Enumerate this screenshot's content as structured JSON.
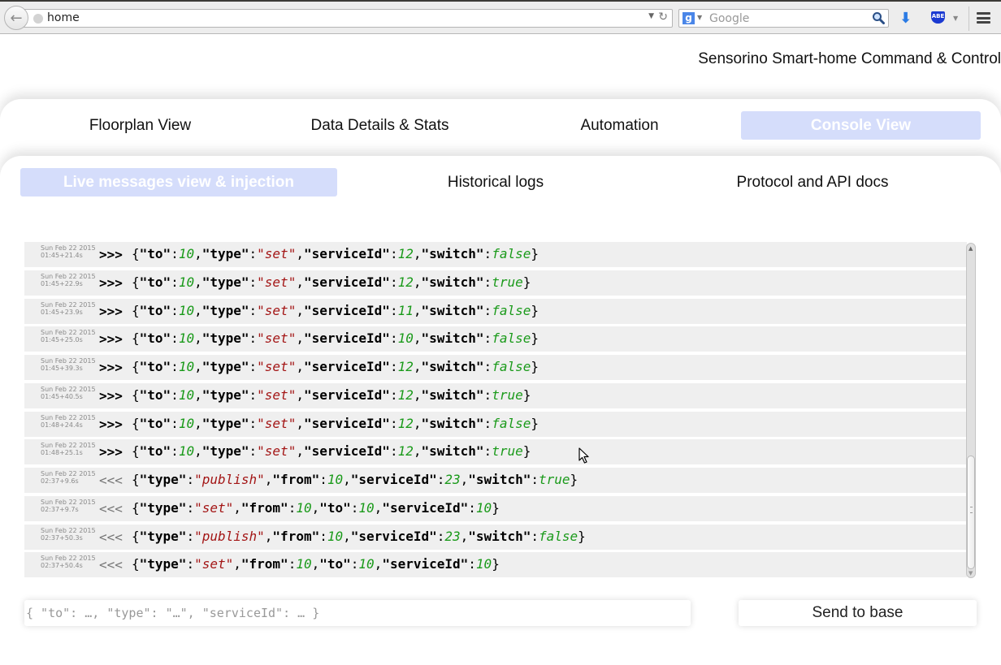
{
  "browser": {
    "url": "home",
    "search_placeholder": "Google",
    "search_engine_icon": "g",
    "extension_label": "ABE"
  },
  "site": {
    "title": "Sensorino Smart-home Command & Control"
  },
  "main_tabs": [
    {
      "label": "Floorplan View",
      "active": false
    },
    {
      "label": "Data Details & Stats",
      "active": false
    },
    {
      "label": "Automation",
      "active": false
    },
    {
      "label": "Console View",
      "active": true
    }
  ],
  "sub_tabs": [
    {
      "label": "Live messages view & injection",
      "active": true
    },
    {
      "label": "Historical logs",
      "active": false
    },
    {
      "label": "Protocol and API docs",
      "active": false
    }
  ],
  "colors": {
    "active_tab_bg": "#d5ddfb",
    "string_value": "#a31515",
    "number_value": "#1a9a1a",
    "row_bg": "#efefef"
  },
  "log": {
    "rows": [
      {
        "date": "Sun Feb 22 2015",
        "time": "01:45+21.4s",
        "dir": ">>>",
        "direction": "out",
        "tokens": [
          [
            "p",
            "{"
          ],
          [
            "k",
            "\"to\""
          ],
          [
            "p",
            ":"
          ],
          [
            "n",
            "10"
          ],
          [
            "p",
            ","
          ],
          [
            "k",
            "\"type\""
          ],
          [
            "p",
            ":"
          ],
          [
            "s",
            "\"set\""
          ],
          [
            "p",
            ","
          ],
          [
            "k",
            "\"serviceId\""
          ],
          [
            "p",
            ":"
          ],
          [
            "n",
            "12"
          ],
          [
            "p",
            ","
          ],
          [
            "k",
            "\"switch\""
          ],
          [
            "p",
            ":"
          ],
          [
            "n",
            "false"
          ],
          [
            "p",
            "}"
          ]
        ]
      },
      {
        "date": "Sun Feb 22 2015",
        "time": "01:45+22.9s",
        "dir": ">>>",
        "direction": "out",
        "tokens": [
          [
            "p",
            "{"
          ],
          [
            "k",
            "\"to\""
          ],
          [
            "p",
            ":"
          ],
          [
            "n",
            "10"
          ],
          [
            "p",
            ","
          ],
          [
            "k",
            "\"type\""
          ],
          [
            "p",
            ":"
          ],
          [
            "s",
            "\"set\""
          ],
          [
            "p",
            ","
          ],
          [
            "k",
            "\"serviceId\""
          ],
          [
            "p",
            ":"
          ],
          [
            "n",
            "12"
          ],
          [
            "p",
            ","
          ],
          [
            "k",
            "\"switch\""
          ],
          [
            "p",
            ":"
          ],
          [
            "n",
            "true"
          ],
          [
            "p",
            "}"
          ]
        ]
      },
      {
        "date": "Sun Feb 22 2015",
        "time": "01:45+23.9s",
        "dir": ">>>",
        "direction": "out",
        "tokens": [
          [
            "p",
            "{"
          ],
          [
            "k",
            "\"to\""
          ],
          [
            "p",
            ":"
          ],
          [
            "n",
            "10"
          ],
          [
            "p",
            ","
          ],
          [
            "k",
            "\"type\""
          ],
          [
            "p",
            ":"
          ],
          [
            "s",
            "\"set\""
          ],
          [
            "p",
            ","
          ],
          [
            "k",
            "\"serviceId\""
          ],
          [
            "p",
            ":"
          ],
          [
            "n",
            "11"
          ],
          [
            "p",
            ","
          ],
          [
            "k",
            "\"switch\""
          ],
          [
            "p",
            ":"
          ],
          [
            "n",
            "false"
          ],
          [
            "p",
            "}"
          ]
        ]
      },
      {
        "date": "Sun Feb 22 2015",
        "time": "01:45+25.0s",
        "dir": ">>>",
        "direction": "out",
        "tokens": [
          [
            "p",
            "{"
          ],
          [
            "k",
            "\"to\""
          ],
          [
            "p",
            ":"
          ],
          [
            "n",
            "10"
          ],
          [
            "p",
            ","
          ],
          [
            "k",
            "\"type\""
          ],
          [
            "p",
            ":"
          ],
          [
            "s",
            "\"set\""
          ],
          [
            "p",
            ","
          ],
          [
            "k",
            "\"serviceId\""
          ],
          [
            "p",
            ":"
          ],
          [
            "n",
            "10"
          ],
          [
            "p",
            ","
          ],
          [
            "k",
            "\"switch\""
          ],
          [
            "p",
            ":"
          ],
          [
            "n",
            "false"
          ],
          [
            "p",
            "}"
          ]
        ]
      },
      {
        "date": "Sun Feb 22 2015",
        "time": "01:45+39.3s",
        "dir": ">>>",
        "direction": "out",
        "tokens": [
          [
            "p",
            "{"
          ],
          [
            "k",
            "\"to\""
          ],
          [
            "p",
            ":"
          ],
          [
            "n",
            "10"
          ],
          [
            "p",
            ","
          ],
          [
            "k",
            "\"type\""
          ],
          [
            "p",
            ":"
          ],
          [
            "s",
            "\"set\""
          ],
          [
            "p",
            ","
          ],
          [
            "k",
            "\"serviceId\""
          ],
          [
            "p",
            ":"
          ],
          [
            "n",
            "12"
          ],
          [
            "p",
            ","
          ],
          [
            "k",
            "\"switch\""
          ],
          [
            "p",
            ":"
          ],
          [
            "n",
            "false"
          ],
          [
            "p",
            "}"
          ]
        ]
      },
      {
        "date": "Sun Feb 22 2015",
        "time": "01:45+40.5s",
        "dir": ">>>",
        "direction": "out",
        "tokens": [
          [
            "p",
            "{"
          ],
          [
            "k",
            "\"to\""
          ],
          [
            "p",
            ":"
          ],
          [
            "n",
            "10"
          ],
          [
            "p",
            ","
          ],
          [
            "k",
            "\"type\""
          ],
          [
            "p",
            ":"
          ],
          [
            "s",
            "\"set\""
          ],
          [
            "p",
            ","
          ],
          [
            "k",
            "\"serviceId\""
          ],
          [
            "p",
            ":"
          ],
          [
            "n",
            "12"
          ],
          [
            "p",
            ","
          ],
          [
            "k",
            "\"switch\""
          ],
          [
            "p",
            ":"
          ],
          [
            "n",
            "true"
          ],
          [
            "p",
            "}"
          ]
        ]
      },
      {
        "date": "Sun Feb 22 2015",
        "time": "01:48+24.4s",
        "dir": ">>>",
        "direction": "out",
        "tokens": [
          [
            "p",
            "{"
          ],
          [
            "k",
            "\"to\""
          ],
          [
            "p",
            ":"
          ],
          [
            "n",
            "10"
          ],
          [
            "p",
            ","
          ],
          [
            "k",
            "\"type\""
          ],
          [
            "p",
            ":"
          ],
          [
            "s",
            "\"set\""
          ],
          [
            "p",
            ","
          ],
          [
            "k",
            "\"serviceId\""
          ],
          [
            "p",
            ":"
          ],
          [
            "n",
            "12"
          ],
          [
            "p",
            ","
          ],
          [
            "k",
            "\"switch\""
          ],
          [
            "p",
            ":"
          ],
          [
            "n",
            "false"
          ],
          [
            "p",
            "}"
          ]
        ]
      },
      {
        "date": "Sun Feb 22 2015",
        "time": "01:48+25.1s",
        "dir": ">>>",
        "direction": "out",
        "tokens": [
          [
            "p",
            "{"
          ],
          [
            "k",
            "\"to\""
          ],
          [
            "p",
            ":"
          ],
          [
            "n",
            "10"
          ],
          [
            "p",
            ","
          ],
          [
            "k",
            "\"type\""
          ],
          [
            "p",
            ":"
          ],
          [
            "s",
            "\"set\""
          ],
          [
            "p",
            ","
          ],
          [
            "k",
            "\"serviceId\""
          ],
          [
            "p",
            ":"
          ],
          [
            "n",
            "12"
          ],
          [
            "p",
            ","
          ],
          [
            "k",
            "\"switch\""
          ],
          [
            "p",
            ":"
          ],
          [
            "n",
            "true"
          ],
          [
            "p",
            "}"
          ]
        ]
      },
      {
        "date": "Sun Feb 22 2015",
        "time": "02:37+9.6s",
        "dir": "<<<",
        "direction": "in",
        "tokens": [
          [
            "p",
            "{"
          ],
          [
            "k",
            "\"type\""
          ],
          [
            "p",
            ":"
          ],
          [
            "s",
            "\"publish\""
          ],
          [
            "p",
            ","
          ],
          [
            "k",
            "\"from\""
          ],
          [
            "p",
            ":"
          ],
          [
            "n",
            "10"
          ],
          [
            "p",
            ","
          ],
          [
            "k",
            "\"serviceId\""
          ],
          [
            "p",
            ":"
          ],
          [
            "n",
            "23"
          ],
          [
            "p",
            ","
          ],
          [
            "k",
            "\"switch\""
          ],
          [
            "p",
            ":"
          ],
          [
            "n",
            "true"
          ],
          [
            "p",
            "}"
          ]
        ]
      },
      {
        "date": "Sun Feb 22 2015",
        "time": "02:37+9.7s",
        "dir": "<<<",
        "direction": "in",
        "tokens": [
          [
            "p",
            "{"
          ],
          [
            "k",
            "\"type\""
          ],
          [
            "p",
            ":"
          ],
          [
            "s",
            "\"set\""
          ],
          [
            "p",
            ","
          ],
          [
            "k",
            "\"from\""
          ],
          [
            "p",
            ":"
          ],
          [
            "n",
            "10"
          ],
          [
            "p",
            ","
          ],
          [
            "k",
            "\"to\""
          ],
          [
            "p",
            ":"
          ],
          [
            "n",
            "10"
          ],
          [
            "p",
            ","
          ],
          [
            "k",
            "\"serviceId\""
          ],
          [
            "p",
            ":"
          ],
          [
            "n",
            "10"
          ],
          [
            "p",
            "}"
          ]
        ]
      },
      {
        "date": "Sun Feb 22 2015",
        "time": "02:37+50.3s",
        "dir": "<<<",
        "direction": "in",
        "tokens": [
          [
            "p",
            "{"
          ],
          [
            "k",
            "\"type\""
          ],
          [
            "p",
            ":"
          ],
          [
            "s",
            "\"publish\""
          ],
          [
            "p",
            ","
          ],
          [
            "k",
            "\"from\""
          ],
          [
            "p",
            ":"
          ],
          [
            "n",
            "10"
          ],
          [
            "p",
            ","
          ],
          [
            "k",
            "\"serviceId\""
          ],
          [
            "p",
            ":"
          ],
          [
            "n",
            "23"
          ],
          [
            "p",
            ","
          ],
          [
            "k",
            "\"switch\""
          ],
          [
            "p",
            ":"
          ],
          [
            "n",
            "false"
          ],
          [
            "p",
            "}"
          ]
        ]
      },
      {
        "date": "Sun Feb 22 2015",
        "time": "02:37+50.4s",
        "dir": "<<<",
        "direction": "in",
        "tokens": [
          [
            "p",
            "{"
          ],
          [
            "k",
            "\"type\""
          ],
          [
            "p",
            ":"
          ],
          [
            "s",
            "\"set\""
          ],
          [
            "p",
            ","
          ],
          [
            "k",
            "\"from\""
          ],
          [
            "p",
            ":"
          ],
          [
            "n",
            "10"
          ],
          [
            "p",
            ","
          ],
          [
            "k",
            "\"to\""
          ],
          [
            "p",
            ":"
          ],
          [
            "n",
            "10"
          ],
          [
            "p",
            ","
          ],
          [
            "k",
            "\"serviceId\""
          ],
          [
            "p",
            ":"
          ],
          [
            "n",
            "10"
          ],
          [
            "p",
            "}"
          ]
        ]
      }
    ]
  },
  "inject": {
    "input_value": "",
    "input_placeholder": "{ \"to\": …, \"type\": \"…\", \"serviceId\": … }",
    "send_label": "Send to base"
  },
  "scroll": {
    "position_fraction": 1.0
  }
}
